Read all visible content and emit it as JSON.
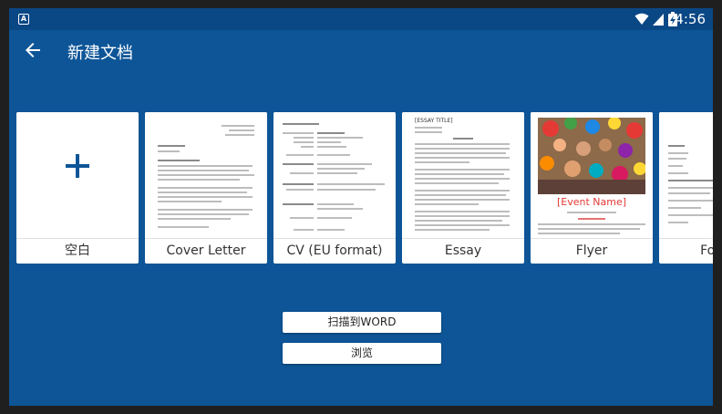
{
  "status_bar": {
    "app_badge": "A",
    "time": "4:56",
    "icons": [
      "wifi-icon",
      "signal-icon",
      "battery-charging-icon"
    ]
  },
  "toolbar": {
    "back_icon": "arrow-left-icon",
    "title": "新建文档"
  },
  "templates": [
    {
      "label": "空白",
      "icon": "plus-icon"
    },
    {
      "label": "Cover Letter"
    },
    {
      "label": "CV (EU format)"
    },
    {
      "label": "Essay",
      "header": "[ESSAY TITLE]"
    },
    {
      "label": "Flyer",
      "event_name": "[Event Name]"
    },
    {
      "label": "Forma"
    }
  ],
  "actions": {
    "scan_label": "扫描到WORD",
    "browse_label": "浏览"
  },
  "colors": {
    "background": "#0d5597",
    "status_bar": "#0a4785",
    "accent": "#0d5597",
    "flyer_red": "#e53935"
  }
}
